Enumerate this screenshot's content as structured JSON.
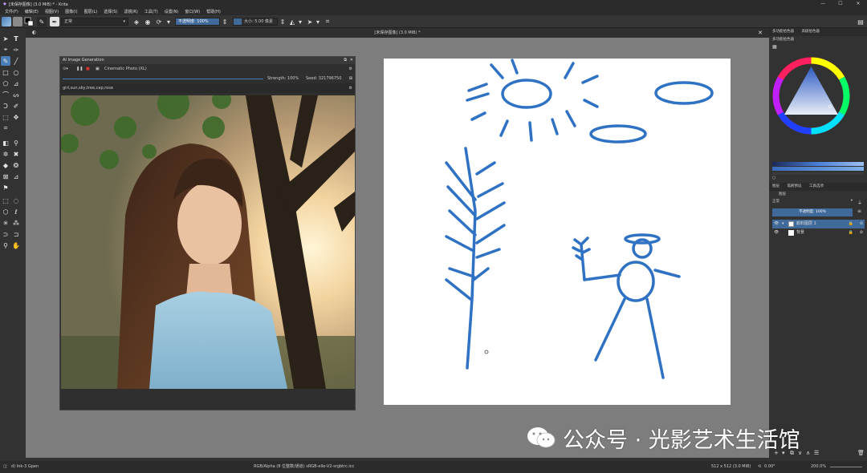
{
  "window": {
    "title": "[未保存图像] (3.0 MiB) * - Krita",
    "controls": [
      "—",
      "☐",
      "✕"
    ]
  },
  "menu": [
    "文件(F)",
    "编辑(E)",
    "视图(V)",
    "图像(I)",
    "图层(L)",
    "选择(S)",
    "滤镜(R)",
    "工具(T)",
    "设置(N)",
    "窗口(W)",
    "帮助(H)"
  ],
  "toolbar": {
    "blend_mode": "正常",
    "opacity_label": "不透明度: 100%",
    "size_label": "大小: 5.00 像素"
  },
  "document": {
    "tab_title": "[未保存图像] (3.0 MiB) *"
  },
  "ai_panel": {
    "title": "AI Image Generation",
    "style": "Cinematic Photo (XL)",
    "strength": "Strength: 100%",
    "seed": "Seed: 321796750",
    "prompt": "girl,sun,sky,tree,cap,rose"
  },
  "right_dock": {
    "top_tabs": [
      "多功能拾色器",
      "高级拾色器"
    ],
    "color_panel_title": "多功能拾色器",
    "layer_tabs": [
      "图层",
      "笔刷预设",
      "工具选项"
    ],
    "layer_panel_title": "图层",
    "blend_mode": "正常",
    "opacity_label": "不透明度: 100%",
    "layers": [
      {
        "name": "颜料图层 1",
        "selected": true
      },
      {
        "name": "背景",
        "selected": false
      }
    ]
  },
  "statusbar": {
    "brush": "d) Ink-3 Gpen",
    "color_space": "RGB/Alpha (8 位整数/通道) sRGB-elle-V2-srgbtrc.icc",
    "image_size": "512 x 512 (3.0 MiB)",
    "rotation": "0.00°",
    "zoom": "200.0%"
  },
  "watermark": {
    "text": "公众号 · 光影艺术生活馆"
  },
  "colors": {
    "sketch_stroke": "#2f72c4",
    "accent_blue": "#4a7fb5",
    "canvas_gray": "#7d7d7d"
  }
}
